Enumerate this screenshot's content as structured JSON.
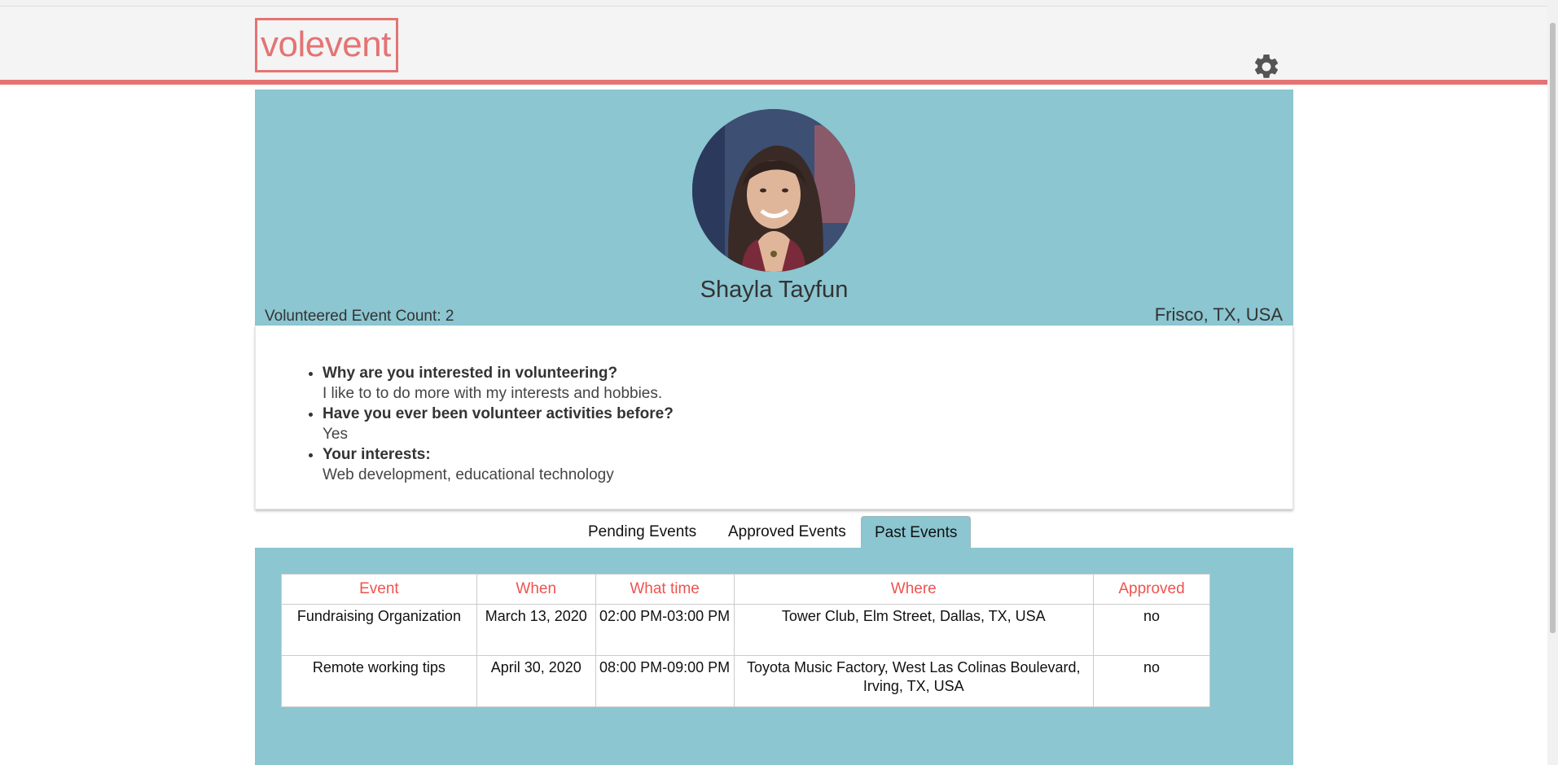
{
  "app": {
    "logo_text": "volevent",
    "accent_color": "#e57373"
  },
  "profile": {
    "name": "Shayla Tayfun",
    "event_count_label": "Volunteered Event Count:",
    "event_count_value": "2",
    "location": "Frisco, TX, USA",
    "avatar_icon": "profile-photo"
  },
  "questions": [
    {
      "question": "Why are you interested in volunteering?",
      "answer": "I like to to do more with my interests and hobbies."
    },
    {
      "question": "Have you ever been volunteer activities before?",
      "answer": "Yes"
    },
    {
      "question": "Your interests:",
      "answer": "Web development, educational technology"
    }
  ],
  "tabs": [
    {
      "label": "Pending Events",
      "active": false
    },
    {
      "label": "Approved Events",
      "active": false
    },
    {
      "label": "Past Events",
      "active": true
    }
  ],
  "events_table": {
    "headers": [
      "Event",
      "When",
      "What time",
      "Where",
      "Approved"
    ],
    "rows": [
      [
        "Fundraising Organization",
        "March 13, 2020",
        "02:00 PM-03:00 PM",
        "Tower Club, Elm Street, Dallas, TX, USA",
        "no"
      ],
      [
        "Remote working tips",
        "April 30, 2020",
        "08:00 PM-09:00 PM",
        "Toyota Music Factory, West Las Colinas Boulevard, Irving, TX, USA",
        "no"
      ]
    ]
  },
  "colors": {
    "panel": "#8bc6d1",
    "header_bg": "#f4f4f4",
    "table_header_text": "#ef5350"
  }
}
